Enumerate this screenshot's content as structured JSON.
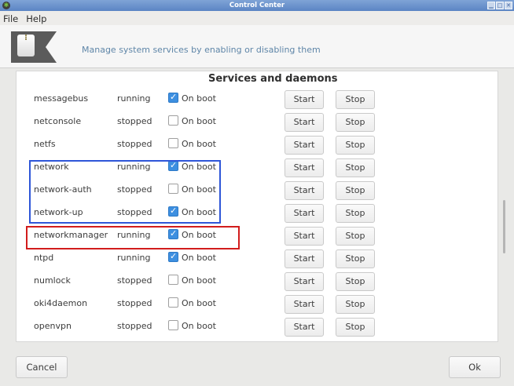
{
  "window": {
    "title": "Control Center",
    "minimize_glyph": "▁",
    "maximize_glyph": "□",
    "close_glyph": "✕"
  },
  "menu": [
    "File",
    "Help"
  ],
  "banner": {
    "icon": "service-manager-icon",
    "message": "Manage system services by enabling or disabling them"
  },
  "section_title": "Services and daemons",
  "onboot_label": "On boot",
  "start_label": "Start",
  "stop_label": "Stop",
  "services": [
    {
      "name": "messagebus",
      "status": "running",
      "on_boot": true
    },
    {
      "name": "netconsole",
      "status": "stopped",
      "on_boot": false
    },
    {
      "name": "netfs",
      "status": "stopped",
      "on_boot": false
    },
    {
      "name": "network",
      "status": "running",
      "on_boot": true
    },
    {
      "name": "network-auth",
      "status": "stopped",
      "on_boot": false
    },
    {
      "name": "network-up",
      "status": "stopped",
      "on_boot": true
    },
    {
      "name": "networkmanager",
      "status": "running",
      "on_boot": true
    },
    {
      "name": "ntpd",
      "status": "running",
      "on_boot": true
    },
    {
      "name": "numlock",
      "status": "stopped",
      "on_boot": false
    },
    {
      "name": "oki4daemon",
      "status": "stopped",
      "on_boot": false
    },
    {
      "name": "openvpn",
      "status": "stopped",
      "on_boot": false
    }
  ],
  "highlight_colors": {
    "group": "#2e56d8",
    "selected": "#d21c1c"
  },
  "footer": {
    "cancel": "Cancel",
    "ok": "Ok"
  }
}
